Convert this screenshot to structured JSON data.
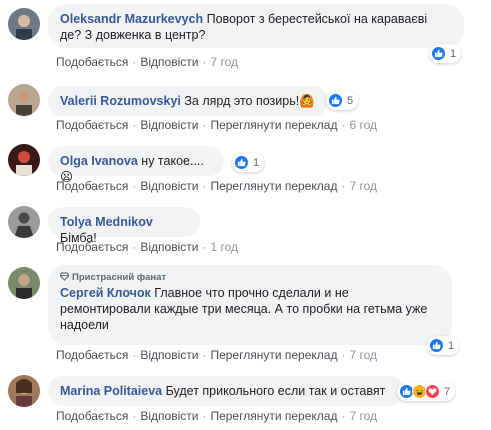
{
  "comments": [
    {
      "author": "Oleksandr Mazurkevych",
      "text": "Поворот з берестейської на караваєві де? З довженка в центр?",
      "line1": "Поворот з берестейської на караваєві",
      "line2": "де? З довженка в центр?",
      "reaction_count": "1",
      "actions": {
        "like": "Подобається",
        "reply": "Відповісти",
        "time": "7 год"
      }
    },
    {
      "author": "Valerii Rozumovskyi",
      "text": "За лярд это позирь!🙆",
      "reaction_count": "5",
      "actions": {
        "like": "Подобається",
        "reply": "Відповісти",
        "translate": "Переглянути переклад",
        "time": "6 год"
      }
    },
    {
      "author": "Olga Ivanova",
      "text": "ну такое....😦",
      "reaction_count": "1",
      "actions": {
        "like": "Подобається",
        "reply": "Відповісти",
        "translate": "Переглянути переклад",
        "time": "7 год"
      }
    },
    {
      "author": "Tolya Mednikov",
      "text": "Бімба!",
      "actions": {
        "like": "Подобається",
        "reply": "Відповісти",
        "time": "1 год"
      }
    },
    {
      "author": "Сергей Клочок",
      "badge": "Пристрасний фанат",
      "line1": "Главное что прочно сделали и не",
      "line2": "ремонтировали каждые три месяца. А то пробки на гетьма уже",
      "line3": "надоели",
      "reaction_count": "1",
      "actions": {
        "like": "Подобається",
        "reply": "Відповісти",
        "translate": "Переглянути переклад",
        "time": "7 год"
      }
    },
    {
      "author": "Marina Politaieva",
      "text": "Будет прикольного если так и оставят",
      "reaction_count": "7",
      "actions": {
        "like": "Подобається",
        "reply": "Відповісти",
        "translate": "Переглянути переклад",
        "time": "7 год"
      }
    }
  ],
  "colors": {
    "author": "#385898",
    "bubble": "#f2f3f5",
    "like_blue": "#1877f2",
    "love_red": "#f33e58",
    "haha_yellow": "#f7b125"
  },
  "icons": {
    "like": "thumbs-up-icon",
    "love": "heart-icon",
    "haha": "laughing-face-icon",
    "badge": "diamond-icon"
  }
}
